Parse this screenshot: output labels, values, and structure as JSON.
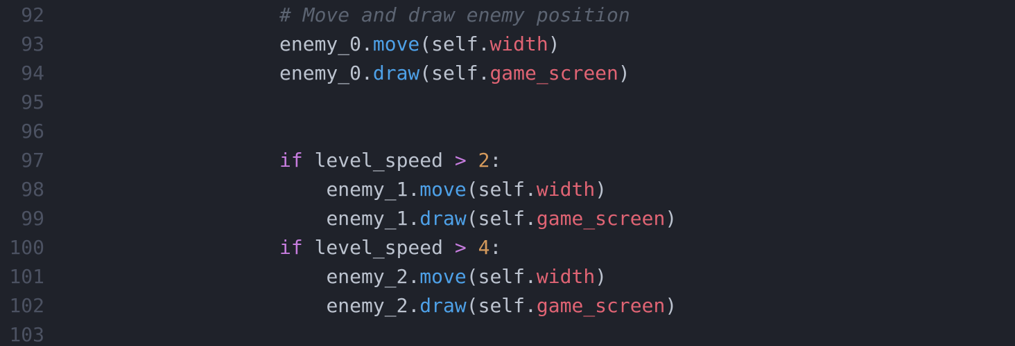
{
  "editor": {
    "theme_colors": {
      "background": "#1f222a",
      "line_number": "#4c5262",
      "text": "#bcc3cf",
      "comment": "#5c6472",
      "method": "#4ea1e8",
      "attribute": "#e06474",
      "keyword": "#c77ddf",
      "number": "#d59a5c"
    },
    "lines": [
      {
        "number": "92",
        "indent": "",
        "tokens": [
          {
            "text": "# Move and draw enemy position",
            "type": "comment"
          }
        ]
      },
      {
        "number": "93",
        "indent": "",
        "tokens": [
          {
            "text": "enemy_0.",
            "type": "text"
          },
          {
            "text": "move",
            "type": "method"
          },
          {
            "text": "(self.",
            "type": "text"
          },
          {
            "text": "width",
            "type": "attr"
          },
          {
            "text": ")",
            "type": "text"
          }
        ]
      },
      {
        "number": "94",
        "indent": "",
        "tokens": [
          {
            "text": "enemy_0.",
            "type": "text"
          },
          {
            "text": "draw",
            "type": "method"
          },
          {
            "text": "(self.",
            "type": "text"
          },
          {
            "text": "game_screen",
            "type": "attr"
          },
          {
            "text": ")",
            "type": "text"
          }
        ]
      },
      {
        "number": "95",
        "indent": "",
        "tokens": []
      },
      {
        "number": "96",
        "indent": "",
        "tokens": []
      },
      {
        "number": "97",
        "indent": "",
        "tokens": [
          {
            "text": "if",
            "type": "keyword"
          },
          {
            "text": " level_speed ",
            "type": "text"
          },
          {
            "text": ">",
            "type": "operator"
          },
          {
            "text": " ",
            "type": "text"
          },
          {
            "text": "2",
            "type": "number"
          },
          {
            "text": ":",
            "type": "text"
          }
        ]
      },
      {
        "number": "98",
        "indent": "    ",
        "tokens": [
          {
            "text": "enemy_1.",
            "type": "text"
          },
          {
            "text": "move",
            "type": "method"
          },
          {
            "text": "(self.",
            "type": "text"
          },
          {
            "text": "width",
            "type": "attr"
          },
          {
            "text": ")",
            "type": "text"
          }
        ]
      },
      {
        "number": "99",
        "indent": "    ",
        "tokens": [
          {
            "text": "enemy_1.",
            "type": "text"
          },
          {
            "text": "draw",
            "type": "method"
          },
          {
            "text": "(self.",
            "type": "text"
          },
          {
            "text": "game_screen",
            "type": "attr"
          },
          {
            "text": ")",
            "type": "text"
          }
        ]
      },
      {
        "number": "100",
        "indent": "",
        "tokens": [
          {
            "text": "if",
            "type": "keyword"
          },
          {
            "text": " level_speed ",
            "type": "text"
          },
          {
            "text": ">",
            "type": "operator"
          },
          {
            "text": " ",
            "type": "text"
          },
          {
            "text": "4",
            "type": "number"
          },
          {
            "text": ":",
            "type": "text"
          }
        ]
      },
      {
        "number": "101",
        "indent": "    ",
        "tokens": [
          {
            "text": "enemy_2.",
            "type": "text"
          },
          {
            "text": "move",
            "type": "method"
          },
          {
            "text": "(self.",
            "type": "text"
          },
          {
            "text": "width",
            "type": "attr"
          },
          {
            "text": ")",
            "type": "text"
          }
        ]
      },
      {
        "number": "102",
        "indent": "    ",
        "tokens": [
          {
            "text": "enemy_2.",
            "type": "text"
          },
          {
            "text": "draw",
            "type": "method"
          },
          {
            "text": "(self.",
            "type": "text"
          },
          {
            "text": "game_screen",
            "type": "attr"
          },
          {
            "text": ")",
            "type": "text"
          }
        ]
      },
      {
        "number": "103",
        "indent": "",
        "tokens": []
      }
    ]
  }
}
